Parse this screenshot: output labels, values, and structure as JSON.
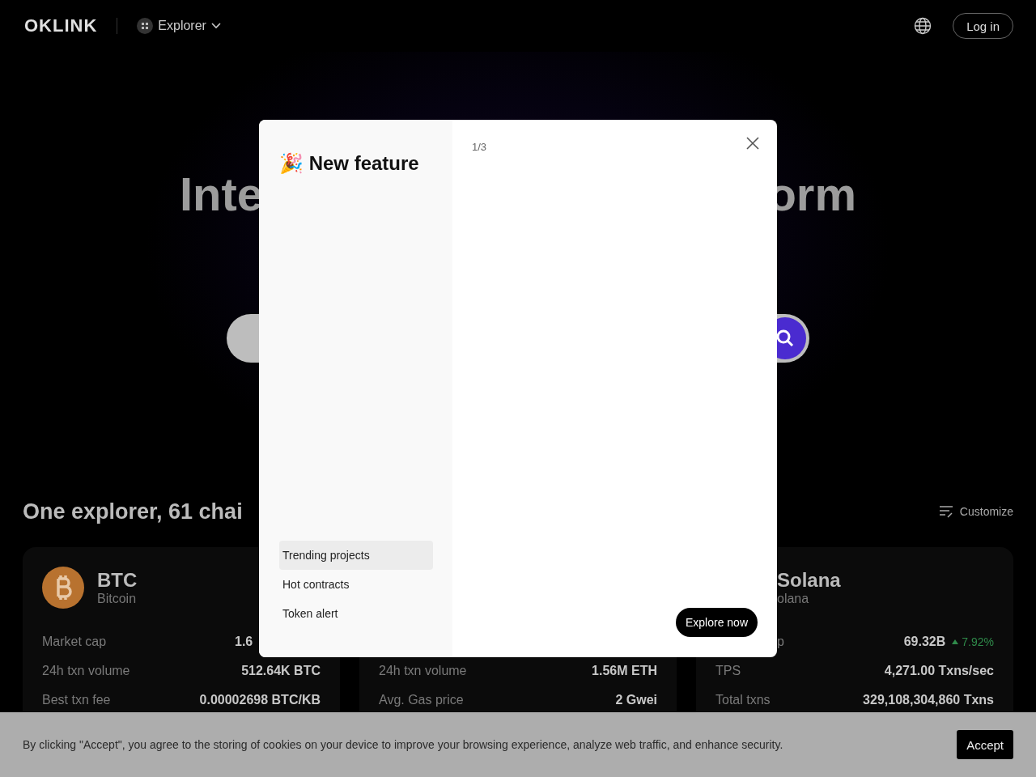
{
  "header": {
    "logo": "OKLINK",
    "explorer_menu": "Explorer",
    "login": "Log in"
  },
  "hero": {
    "title_left": "Inte",
    "title_right": "orm"
  },
  "section": {
    "title": "One explorer, 61 chai",
    "customize": "Customize"
  },
  "cards": [
    {
      "kind": "full",
      "symbol": "BTC",
      "name": "Bitcoin",
      "rows": [
        {
          "label": "Market cap",
          "value": "1.6",
          "partial": true
        },
        {
          "label": "24h txn volume",
          "value": "512.64K BTC",
          "partial": false
        },
        {
          "label": "Best txn fee",
          "value": "0.00002698 BTC/KB",
          "partial": false
        }
      ]
    },
    {
      "kind": "covered_top",
      "rows": [
        {
          "label": "24h txn volume",
          "value": "1.56M ETH",
          "partial": false
        },
        {
          "label": "Avg. Gas price",
          "value": "2 Gwei",
          "partial": false
        }
      ]
    },
    {
      "kind": "clipped_left",
      "symbol": "Solana",
      "name": "olana",
      "rows": [
        {
          "label": "p",
          "value": "69.32B",
          "change": "7.92%",
          "partial": false
        },
        {
          "label": "TPS",
          "value": "4,271.00 Txns/sec",
          "partial": false
        },
        {
          "label": "Total txns",
          "value": "329,108,304,860 Txns",
          "partial": false
        }
      ]
    }
  ],
  "modal": {
    "title": "🎉 New feature",
    "counter": "1/3",
    "button": "Explore now",
    "items": [
      {
        "label": "Trending projects",
        "selected": true
      },
      {
        "label": "Hot contracts",
        "selected": false
      },
      {
        "label": "Token alert",
        "selected": false
      }
    ]
  },
  "cookie": {
    "text": "By clicking \"Accept\", you agree to the storing of cookies on your device to improve your browsing experience, analyze web traffic, and enhance security.",
    "button": "Accept"
  }
}
